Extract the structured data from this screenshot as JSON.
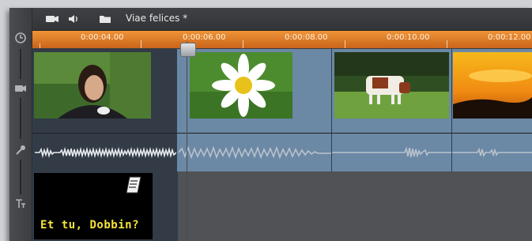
{
  "project": {
    "title": "Viae felices *"
  },
  "toolbar": {
    "icons": [
      "camera-icon",
      "speaker-icon",
      "folder-icon"
    ]
  },
  "sidebar": {
    "icons": [
      "clock-icon",
      "video-camera-icon",
      "microphone-icon",
      "title-icon"
    ]
  },
  "ruler": {
    "timecodes": [
      "0:00:04.00",
      "0:00:06.00",
      "0:00:08.00",
      "0:00:10.00",
      "0:00:12.00"
    ]
  },
  "title_clip": {
    "text": "Et tu, Dobbin?"
  },
  "colors": {
    "ruler": "#e07a24",
    "clip": "#6b88a5",
    "title_text": "#f4e33a"
  }
}
